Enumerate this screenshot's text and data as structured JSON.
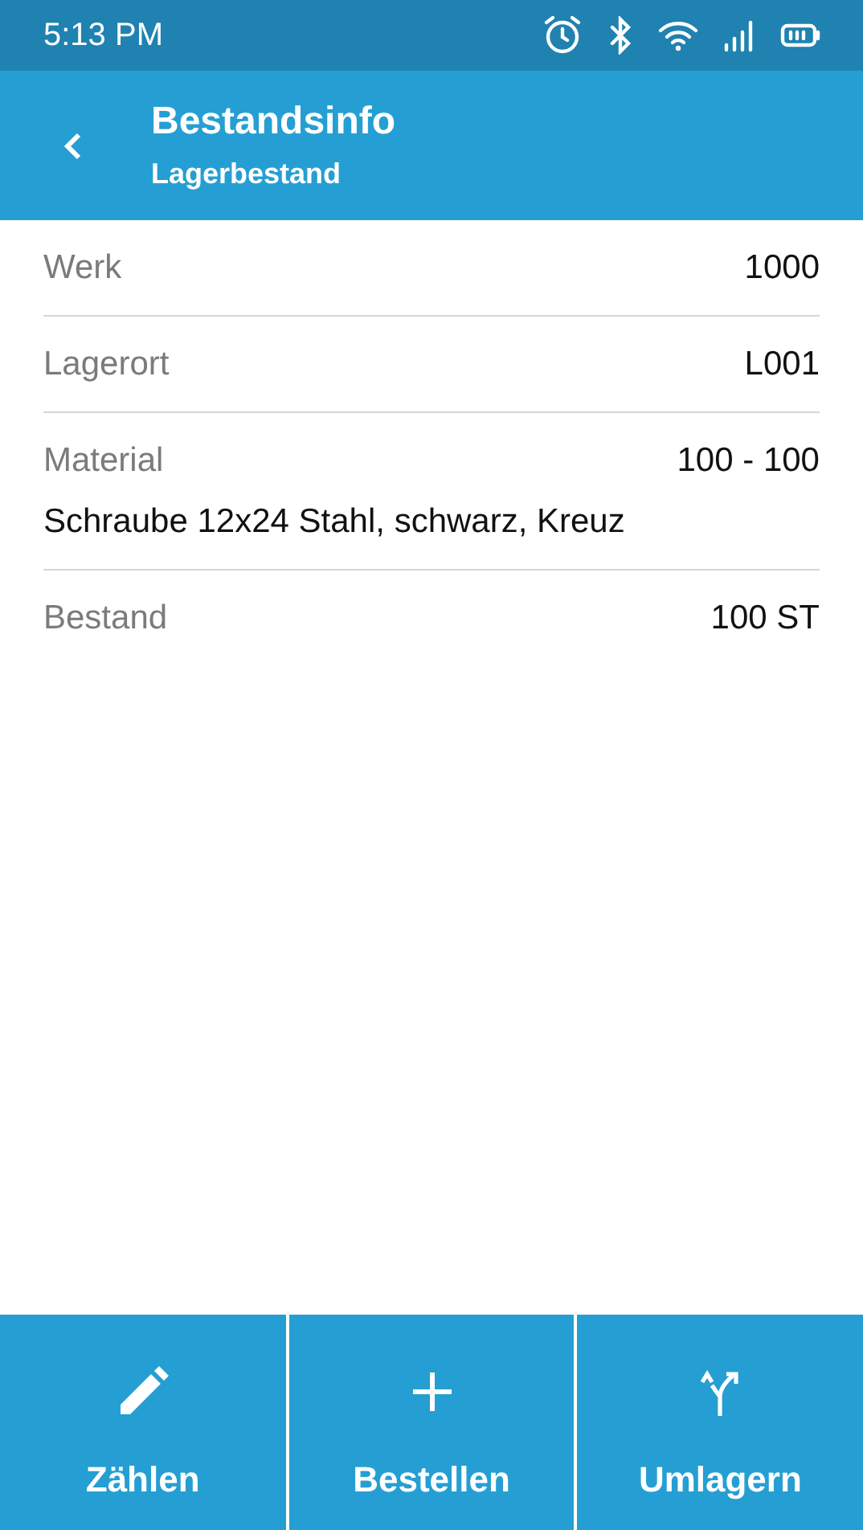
{
  "status_bar": {
    "time": "5:13 PM"
  },
  "app_bar": {
    "title": "Bestandsinfo",
    "subtitle": "Lagerbestand"
  },
  "fields": [
    {
      "label": "Werk",
      "value": "1000"
    },
    {
      "label": "Lagerort",
      "value": "L001"
    },
    {
      "label": "Material",
      "value": "100 - 100",
      "description": "Schraube 12x24 Stahl, schwarz, Kreuz"
    },
    {
      "label": "Bestand",
      "value": "100 ST"
    }
  ],
  "actions": [
    {
      "label": "Zählen"
    },
    {
      "label": "Bestellen"
    },
    {
      "label": "Umlagern"
    }
  ]
}
